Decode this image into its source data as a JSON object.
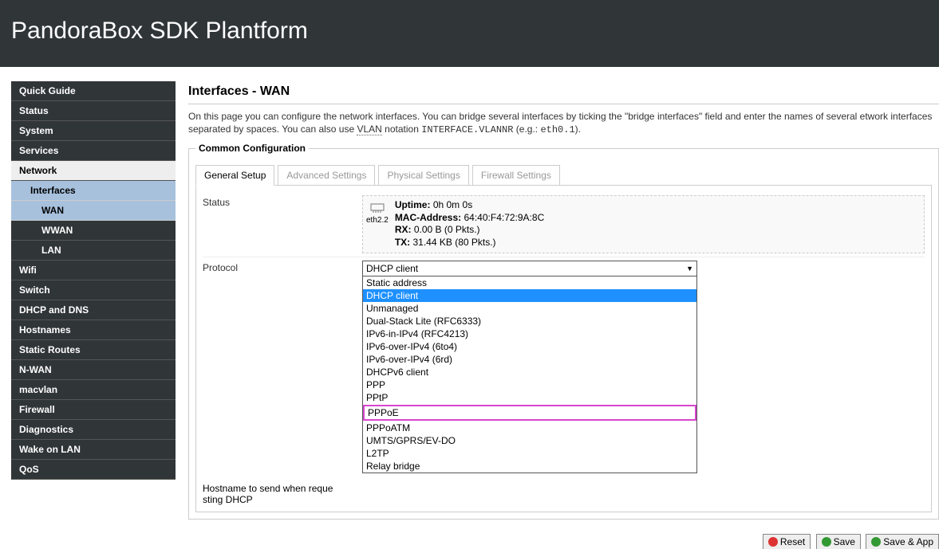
{
  "header": {
    "title": "PandoraBox SDK Plantform"
  },
  "sidebar": {
    "items": [
      {
        "label": "Quick Guide",
        "type": "top"
      },
      {
        "label": "Status",
        "type": "top"
      },
      {
        "label": "System",
        "type": "top"
      },
      {
        "label": "Services",
        "type": "top"
      },
      {
        "label": "Network",
        "type": "top-active"
      },
      {
        "label": "Interfaces",
        "type": "sub-active"
      },
      {
        "label": "WAN",
        "type": "sub2-active"
      },
      {
        "label": "WWAN",
        "type": "sub2"
      },
      {
        "label": "LAN",
        "type": "sub2"
      },
      {
        "label": "Wifi",
        "type": "sub"
      },
      {
        "label": "Switch",
        "type": "sub"
      },
      {
        "label": "DHCP and DNS",
        "type": "sub"
      },
      {
        "label": "Hostnames",
        "type": "sub"
      },
      {
        "label": "Static Routes",
        "type": "sub"
      },
      {
        "label": "N-WAN",
        "type": "sub"
      },
      {
        "label": "macvlan",
        "type": "sub"
      },
      {
        "label": "Firewall",
        "type": "sub"
      },
      {
        "label": "Diagnostics",
        "type": "sub"
      },
      {
        "label": "Wake on LAN",
        "type": "sub"
      },
      {
        "label": "QoS",
        "type": "sub"
      }
    ]
  },
  "main": {
    "title": "Interfaces - WAN",
    "desc_p1": "On this page you can configure the network interfaces. You can bridge several interfaces by ticking the \"bridge interfaces\" field and enter the names of several etwork interfaces separated by spaces. You can also use ",
    "desc_vlan": "VLAN",
    "desc_p2": " notation ",
    "desc_code1": "INTERFACE.VLANNR",
    "desc_p3": " (e.g.: ",
    "desc_code2": "eth0.1",
    "desc_p4": ").",
    "fieldset_legend": "Common Configuration",
    "tabs": [
      {
        "label": "General Setup",
        "active": true
      },
      {
        "label": "Advanced Settings",
        "active": false
      },
      {
        "label": "Physical Settings",
        "active": false
      },
      {
        "label": "Firewall Settings",
        "active": false
      }
    ],
    "status": {
      "label": "Status",
      "iface": "eth2.2",
      "uptime_label": "Uptime:",
      "uptime_value": "0h 0m 0s",
      "mac_label": "MAC-Address:",
      "mac_value": "64:40:F4:72:9A:8C",
      "rx_label": "RX:",
      "rx_value": "0.00 B (0 Pkts.)",
      "tx_label": "TX:",
      "tx_value": "31.44 KB (80 Pkts.)"
    },
    "protocol": {
      "label": "Protocol",
      "selected": "DHCP client",
      "options": [
        "Static address",
        "DHCP client",
        "Unmanaged",
        "Dual-Stack Lite (RFC6333)",
        "IPv6-in-IPv4 (RFC4213)",
        "IPv6-over-IPv4 (6to4)",
        "IPv6-over-IPv4 (6rd)",
        "DHCPv6 client",
        "PPP",
        "PPtP",
        "PPPoE",
        "PPPoATM",
        "UMTS/GPRS/EV-DO",
        "L2TP",
        "Relay bridge"
      ],
      "highlighted_index": 10
    },
    "hostname": {
      "label_line1": "Hostname to send when reque",
      "label_line2": "sting DHCP"
    },
    "buttons": {
      "reset": "Reset",
      "save": "Save",
      "apply": "Save & App"
    }
  }
}
